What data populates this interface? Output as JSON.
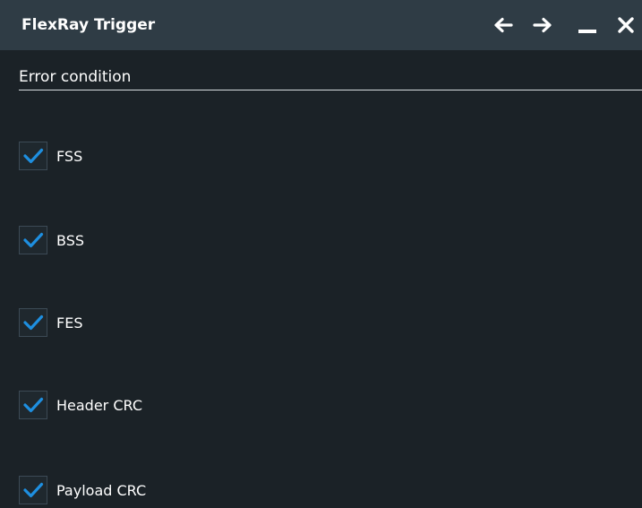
{
  "window": {
    "title": "FlexRay Trigger",
    "controls": {
      "back": "arrow-left-icon",
      "forward": "arrow-right-icon",
      "minimize": "minimize-icon",
      "close": "close-icon"
    }
  },
  "section": {
    "title": "Error condition"
  },
  "conditions": [
    {
      "label": "FSS",
      "checked": true
    },
    {
      "label": "BSS",
      "checked": true
    },
    {
      "label": "FES",
      "checked": true
    },
    {
      "label": "Header CRC",
      "checked": true
    },
    {
      "label": "Payload CRC",
      "checked": true
    }
  ],
  "colors": {
    "background": "#1b2227",
    "titlebar": "#2f3c45",
    "checkmark": "#1e8fe0",
    "text": "#ffffff"
  }
}
